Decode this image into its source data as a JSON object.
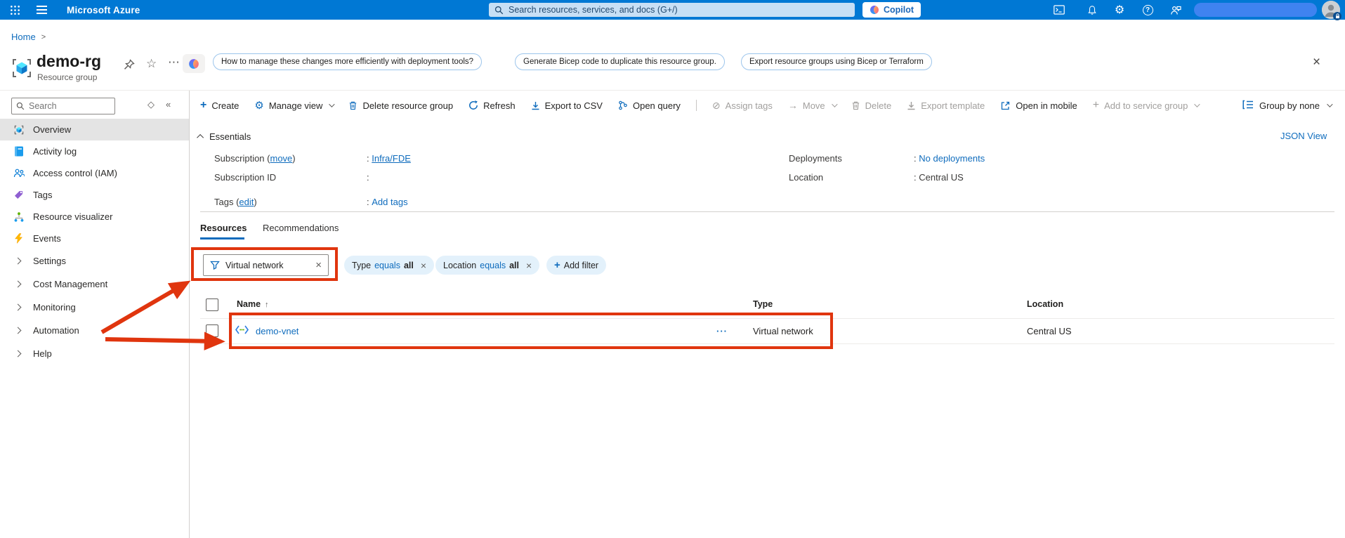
{
  "topbar": {
    "brand": "Microsoft Azure",
    "search_placeholder": "Search resources, services, and docs (G+/)",
    "copilot_label": "Copilot"
  },
  "breadcrumb": {
    "home": "Home"
  },
  "page": {
    "title": "demo-rg",
    "subtitle": "Resource group",
    "suggestions": [
      "How to manage these changes more efficiently with deployment tools?",
      "Generate Bicep code to duplicate this resource group.",
      "Export resource groups using Bicep or Terraform"
    ]
  },
  "sidebar": {
    "search_placeholder": "Search",
    "items": [
      {
        "label": "Overview",
        "selected": true
      },
      {
        "label": "Activity log"
      },
      {
        "label": "Access control (IAM)"
      },
      {
        "label": "Tags"
      },
      {
        "label": "Resource visualizer"
      },
      {
        "label": "Events"
      }
    ],
    "groups": [
      {
        "label": "Settings"
      },
      {
        "label": "Cost Management"
      },
      {
        "label": "Monitoring"
      },
      {
        "label": "Automation"
      },
      {
        "label": "Help"
      }
    ]
  },
  "toolbar": {
    "items": [
      {
        "label": "Create",
        "enabled": true
      },
      {
        "label": "Manage view",
        "enabled": true
      },
      {
        "label": "Delete resource group",
        "enabled": true
      },
      {
        "label": "Refresh",
        "enabled": true
      },
      {
        "label": "Export to CSV",
        "enabled": true
      },
      {
        "label": "Open query",
        "enabled": true
      },
      {
        "label": "Assign tags",
        "enabled": false
      },
      {
        "label": "Move",
        "enabled": false
      },
      {
        "label": "Delete",
        "enabled": false
      },
      {
        "label": "Export template",
        "enabled": false
      },
      {
        "label": "Open in mobile",
        "enabled": true
      },
      {
        "label": "Add to service group",
        "enabled": false
      }
    ],
    "group_by": "Group by none"
  },
  "essentials": {
    "header": "Essentials",
    "json_view": "JSON View",
    "left": [
      {
        "label_prefix": "Subscription (",
        "label_link": "move",
        "label_suffix": ")",
        "value": "Infra/FDE"
      },
      {
        "label": "Subscription ID",
        "value": ""
      },
      {
        "label_prefix": "Tags (",
        "label_link": "edit",
        "label_suffix": ")",
        "value": "Add tags"
      }
    ],
    "right": [
      {
        "label": "Deployments",
        "value": "No deployments"
      },
      {
        "label": "Location",
        "value": "Central US"
      }
    ]
  },
  "tabs": [
    {
      "label": "Resources"
    },
    {
      "label": "Recommendations"
    }
  ],
  "filters": {
    "value": "Virtual network",
    "pills": [
      {
        "field": "Type",
        "op": "equals",
        "val": "all"
      },
      {
        "field": "Location",
        "op": "equals",
        "val": "all"
      }
    ],
    "add_label": "Add filter"
  },
  "table": {
    "columns": [
      {
        "label": "Name"
      },
      {
        "label": "Type"
      },
      {
        "label": "Location"
      }
    ],
    "rows": [
      {
        "name": "demo-vnet",
        "type": "Virtual network",
        "location": "Central US"
      }
    ]
  },
  "icons": {
    "star": "☆",
    "more": "⋯",
    "close": "×",
    "collapse": "«",
    "dock": "◇",
    "sort-asc": "↑",
    "gear": "⚙",
    "blocked": "⊘",
    "move-arrow": "→",
    "plus": "+",
    "question": "?",
    "colon": ":",
    "breadcrumb-sep": ">",
    "row-menu": "···"
  },
  "colors": {
    "topbar-bg": "#0078d4",
    "topbar-search-bg": "#c7dff5",
    "accent-blue": "#0f6cbd",
    "annotation-red": "#e0350e",
    "redaction-blue": "#3f83f0",
    "selected-bg": "#e4e4e4",
    "pill-bg": "#e3f1fb"
  }
}
